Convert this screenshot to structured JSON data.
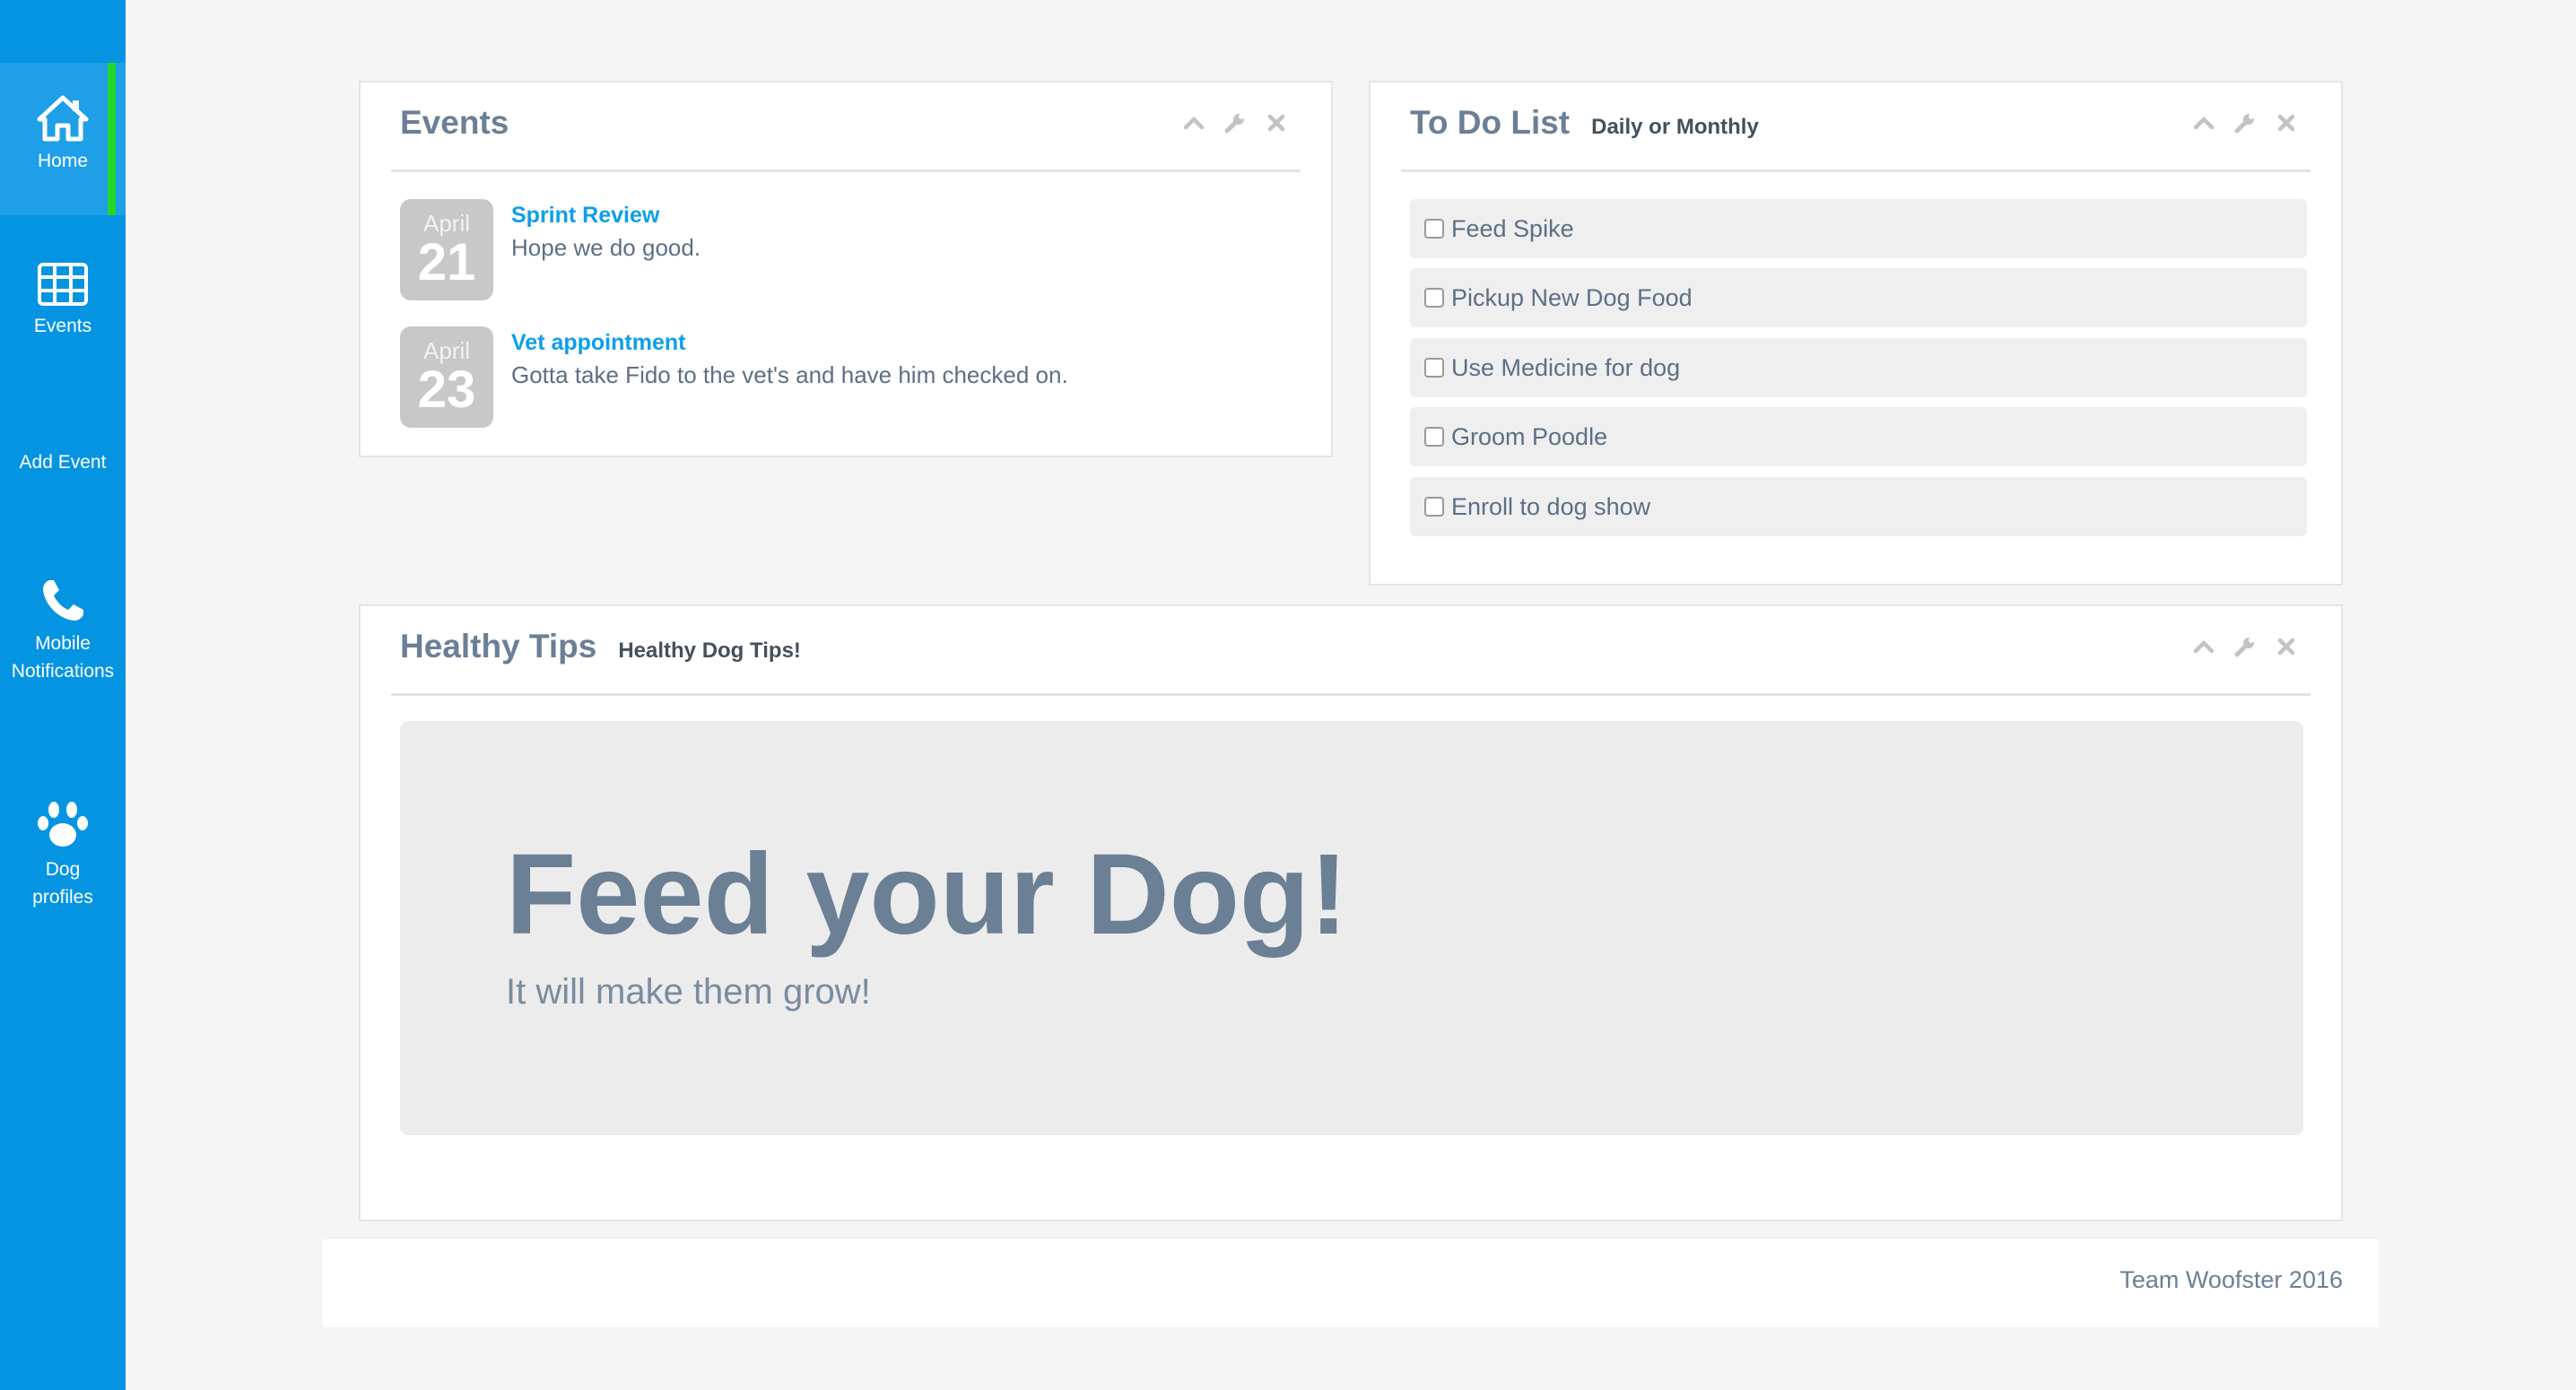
{
  "sidebar": {
    "items": [
      {
        "label": "Home",
        "icon": "home-icon",
        "active": true
      },
      {
        "label": "Events",
        "icon": "calendar-grid-icon"
      },
      {
        "label": "Add Event",
        "icon": ""
      },
      {
        "label": "Mobile Notifications",
        "icon": "phone-icon"
      },
      {
        "label": "Dog profiles",
        "icon": "paw-icon"
      }
    ],
    "accent_color": "#0594e2",
    "active_indicator_color": "#22d62a"
  },
  "events_panel": {
    "title": "Events",
    "events": [
      {
        "month": "April",
        "day": "21",
        "title": "Sprint Review",
        "description": "Hope we do good."
      },
      {
        "month": "April",
        "day": "23",
        "title": "Vet appointment",
        "description": "Gotta take Fido to the vet's and have him checked on."
      }
    ]
  },
  "todo_panel": {
    "title": "To Do List",
    "subtitle": "Daily or Monthly",
    "items": [
      {
        "label": "Feed Spike",
        "checked": false
      },
      {
        "label": "Pickup New Dog Food",
        "checked": false
      },
      {
        "label": "Use Medicine for dog",
        "checked": false
      },
      {
        "label": "Groom Poodle",
        "checked": false
      },
      {
        "label": "Enroll to dog show",
        "checked": false
      }
    ]
  },
  "tips_panel": {
    "title": "Healthy Tips",
    "subtitle": "Healthy Dog Tips!",
    "headline": "Feed your Dog!",
    "tagline": "It will make them grow!"
  },
  "panel_tools": [
    "chevron-up-icon",
    "wrench-icon",
    "close-icon"
  ],
  "footer": {
    "text": "Team Woofster 2016"
  }
}
